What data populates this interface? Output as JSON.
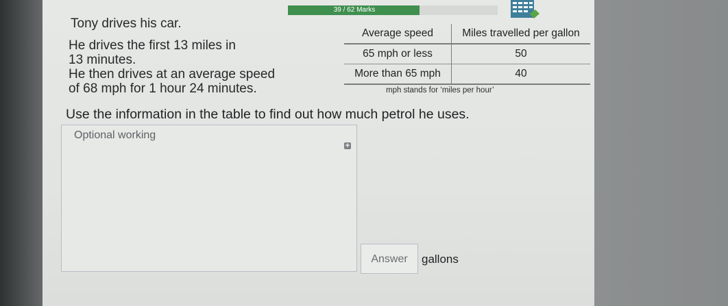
{
  "header": {
    "progress_text": "39 / 62 Marks",
    "progress_fraction": 0.629,
    "calculator_icon": "calculator-icon",
    "accent_color": "#3f8f4e"
  },
  "question": {
    "line1": "Tony drives his car.",
    "line2": "He drives the first 13 miles in",
    "line3": "13 minutes.",
    "line4": "He then drives at an average speed",
    "line5": "of 68 mph for 1 hour 24 minutes.",
    "instruction": "Use the information in the table to find out how much petrol he uses."
  },
  "table": {
    "headers": [
      "Average speed",
      "Miles travelled per gallon"
    ],
    "rows": [
      [
        "65 mph or less",
        "50"
      ],
      [
        "More than 65 mph",
        "40"
      ]
    ],
    "footnote": "mph stands for ‘miles per hour’"
  },
  "working": {
    "label": "Optional working",
    "expand_icon": "plus-icon"
  },
  "answer": {
    "placeholder": "Answer",
    "unit": "gallons"
  }
}
